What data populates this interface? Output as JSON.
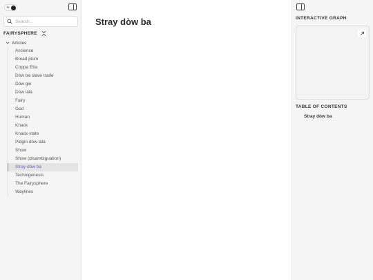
{
  "sidebar": {
    "search": {
      "placeholder": "Search..."
    },
    "site_title": "FAIRYSPHERE",
    "folder": "Articles",
    "items": [
      "Ascience",
      "Bread plum",
      "Coppa Etta",
      "Dów ba slave trade",
      "Dów gie",
      "Dów lálá",
      "Fairy",
      "God",
      "Human",
      "Knack",
      "Knack-state",
      "Pidgin dów lálá",
      "Show",
      "Show (disambiguation)",
      "Stray dòw ba",
      "Technigenesis",
      "The Fairysphere",
      "Waylines"
    ],
    "active_index": 14
  },
  "main": {
    "title": "Stray dòw ba"
  },
  "right": {
    "graph_heading": "INTERACTIVE GRAPH",
    "toc_heading": "TABLE OF CONTENTS",
    "toc_items": [
      "Stray dòw ba"
    ]
  },
  "colors": {
    "accent": "#7c6bd6",
    "active_bg": "#e4e4e4"
  },
  "icons": {
    "theme": "sun-moon-toggle-icon",
    "panel": "sidebar-panel-icon",
    "search": "search-icon",
    "collapse": "collapse-icon",
    "folder": "chevron-down-icon",
    "expand": "arrow-up-right-icon"
  }
}
